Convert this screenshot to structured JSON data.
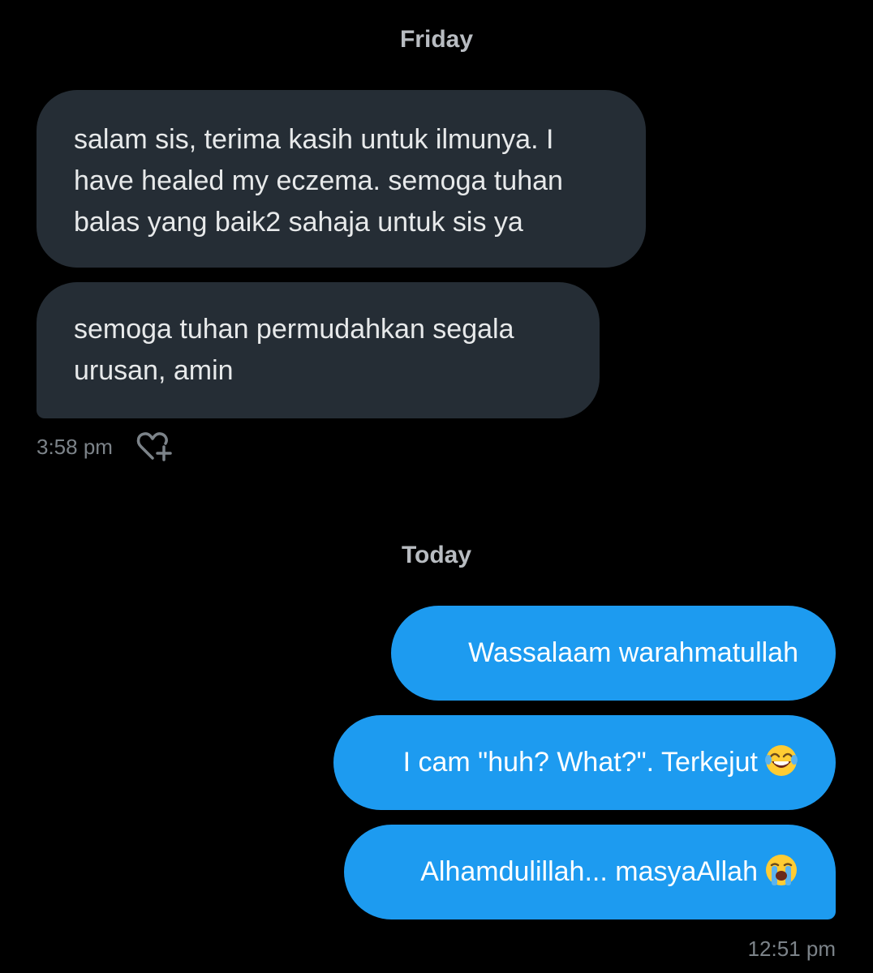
{
  "conversation": {
    "sections": [
      {
        "date_label": "Friday",
        "messages": [
          {
            "text": "salam sis, terima kasih untuk ilmunya. I have healed my eczema. semoga tuhan balas yang baik2 sahaja untuk sis ya"
          },
          {
            "text": "semoga tuhan permudahkan segala urusan, amin"
          }
        ],
        "timestamp": "3:58 pm"
      },
      {
        "date_label": "Today",
        "messages": [
          {
            "text": "Wassalaam warahmatullah"
          },
          {
            "text": "I cam \"huh? What?\". Terkejut",
            "emoji": "face-with-tears-of-joy-emoji"
          },
          {
            "text": "Alhamdulillah... masyaAllah",
            "emoji": "loudly-crying-face-emoji"
          }
        ],
        "timestamp": "12:51 pm"
      }
    ],
    "icons": {
      "react": "heart-plus-icon"
    },
    "colors": {
      "background": "#000000",
      "received_bubble": "#252d35",
      "sent_bubble": "#1d9bf0",
      "date_label": "#b8bcc1",
      "timestamp": "#7c8389"
    }
  }
}
